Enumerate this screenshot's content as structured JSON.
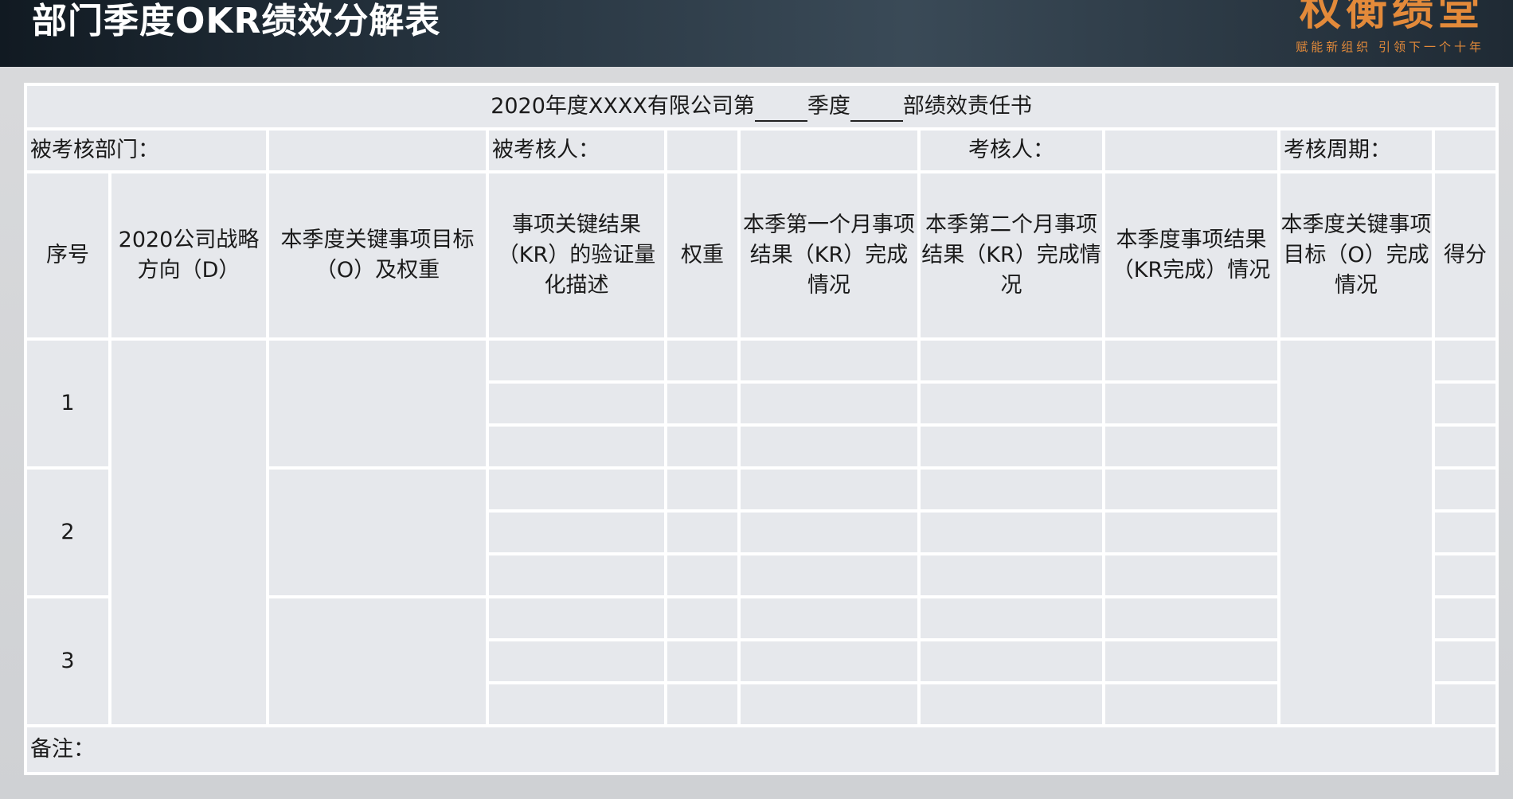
{
  "banner": {
    "title": "部门季度OKR绩效分解表",
    "logo_text": "权衡绩堂",
    "logo_subtitle": "赋能新组织 引领下一个十年"
  },
  "sheet": {
    "title_prefix": "2020年度XXXX有限公司第",
    "title_mid": "季度",
    "title_suffix": "部绩效责任书",
    "info_row": {
      "dept_label": "被考核部门：",
      "assessee_label": "被考核人：",
      "assessor_label": "考核人：",
      "period_label": "考核周期："
    },
    "headers": [
      "序号",
      "2020公司战略方向（D）",
      "本季度关键事项目标（O）及权重",
      "事项关键结果（KR）的验证量化描述",
      "权重",
      "本季第一个月事项结果（KR）完成情况",
      "本季第二个月事项结果（KR）完成情况",
      "本季度事项结果（KR完成）情况",
      "本季度关键事项目标（O）完成情况",
      "得分"
    ],
    "rows": [
      "1",
      "2",
      "3"
    ],
    "remarks_label": "备注："
  }
}
